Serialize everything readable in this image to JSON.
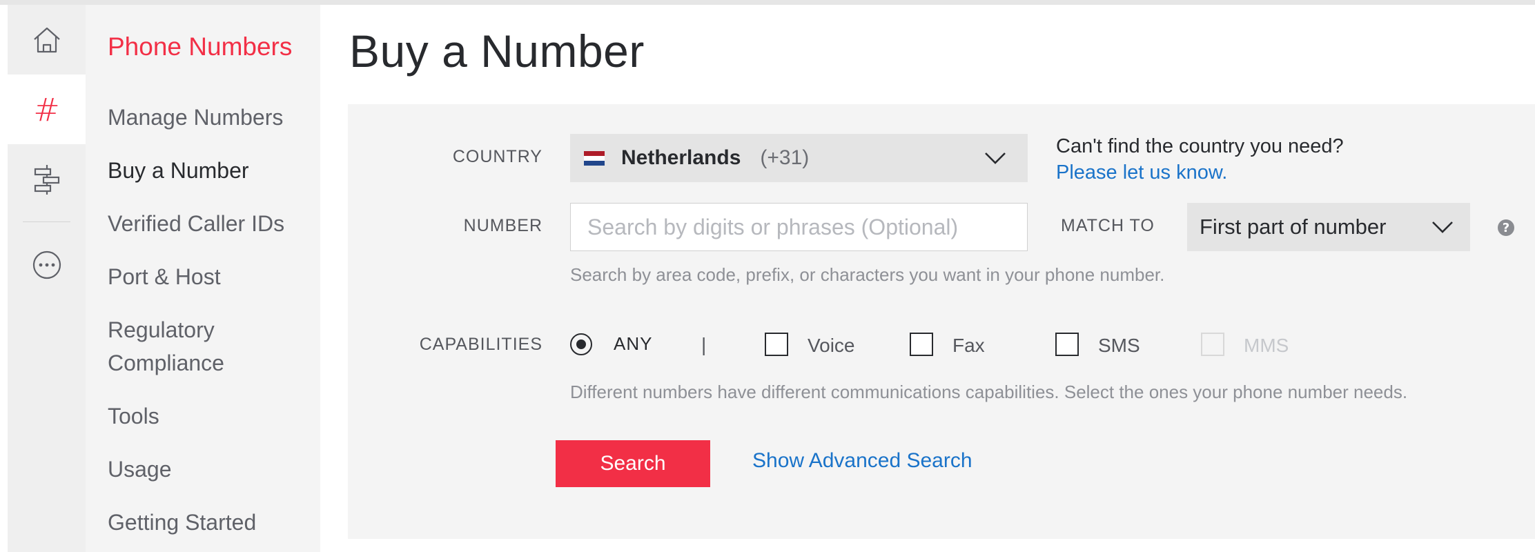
{
  "rail": {
    "items": [
      {
        "icon": "home-icon",
        "active": false
      },
      {
        "icon": "hash-icon",
        "active": true
      },
      {
        "icon": "sitemap-icon",
        "active": false
      },
      {
        "icon": "more-icon",
        "active": false
      }
    ],
    "hash_glyph": "#"
  },
  "sidebar": {
    "title": "Phone Numbers",
    "items": [
      {
        "label": "Manage Numbers"
      },
      {
        "label": "Buy a Number",
        "current": true
      },
      {
        "label": "Verified Caller IDs"
      },
      {
        "label": "Port & Host"
      },
      {
        "label": "Regulatory"
      },
      {
        "label": "Compliance"
      },
      {
        "label": "Tools"
      },
      {
        "label": "Usage"
      },
      {
        "label": "Getting Started"
      }
    ]
  },
  "page": {
    "title": "Buy a Number"
  },
  "form": {
    "country": {
      "label": "COUNTRY",
      "name": "Netherlands",
      "code": "(+31)",
      "flag_colors": [
        "#ae1c28",
        "#ffffff",
        "#21468b"
      ],
      "help_text": "Can't find the country you need?",
      "help_link": "Please let us know."
    },
    "number": {
      "label": "NUMBER",
      "value": "",
      "placeholder": "Search by digits or phrases (Optional)",
      "hint": "Search by area code, prefix, or characters you want in your phone number."
    },
    "match_to": {
      "label": "MATCH TO",
      "selected": "First part of number",
      "help_icon": "question-circle-icon",
      "help_glyph": "?"
    },
    "capabilities": {
      "label": "CAPABILITIES",
      "any_label": "ANY",
      "any_selected": true,
      "separator": "|",
      "options": [
        {
          "label": "Voice",
          "checked": false,
          "disabled": false
        },
        {
          "label": "Fax",
          "checked": false,
          "disabled": false
        },
        {
          "label": "SMS",
          "checked": false,
          "disabled": false
        },
        {
          "label": "MMS",
          "checked": false,
          "disabled": true
        }
      ],
      "hint": "Different numbers have different communications capabilities. Select the ones your phone number needs."
    },
    "search_button": "Search",
    "advanced_link": "Show Advanced Search"
  },
  "colors": {
    "accent": "#f22f46",
    "link": "#1a73c9",
    "panel_bg": "#f4f4f4"
  }
}
